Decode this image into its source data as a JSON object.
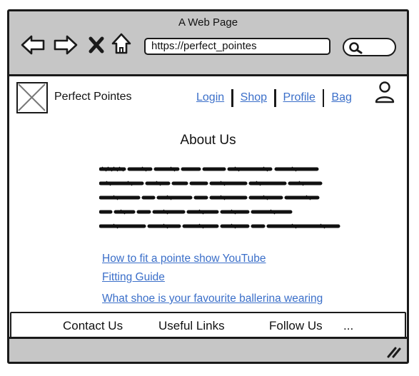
{
  "window": {
    "title": "A Web Page"
  },
  "browser": {
    "url": "https://perfect_pointes",
    "icons": [
      "back-arrow-icon",
      "forward-arrow-icon",
      "close-x-icon",
      "home-icon",
      "search-icon",
      "resize-grip-icon"
    ]
  },
  "header": {
    "brand": "Perfect Pointes",
    "logo_icon": "image-placeholder-icon",
    "nav": [
      "Login",
      "Shop",
      "Profile",
      "Bag"
    ],
    "user_icon": "user-icon"
  },
  "main": {
    "heading": "About Us",
    "body_placeholder": "scribbled-text",
    "links": [
      "How to fit a pointe show YouTube",
      "Fitting Guide",
      "What shoe is your favourite ballerina wearing"
    ]
  },
  "footer": {
    "items": [
      "Contact Us",
      "Useful Links",
      "Follow Us",
      "..."
    ]
  },
  "colors": {
    "chrome": "#c6c6c6",
    "link": "#3b6fc9",
    "ink": "#1a1a1a"
  }
}
